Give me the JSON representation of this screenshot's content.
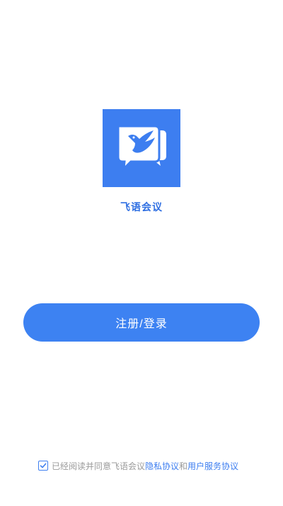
{
  "app": {
    "name": "飞语会议"
  },
  "actions": {
    "login_label": "注册/登录"
  },
  "agreement": {
    "checked": true,
    "prefix_text": "已经阅读并同意飞语会议",
    "privacy_link": "隐私协议",
    "joiner": "和",
    "service_link": "用户服务协议"
  },
  "colors": {
    "brand_blue": "#3d7ef0",
    "button_blue": "#3d82f2",
    "muted_text": "#9a9a9a"
  },
  "icons": {
    "logo": "chat-bubbles-bird-icon",
    "check": "checkmark-icon"
  }
}
